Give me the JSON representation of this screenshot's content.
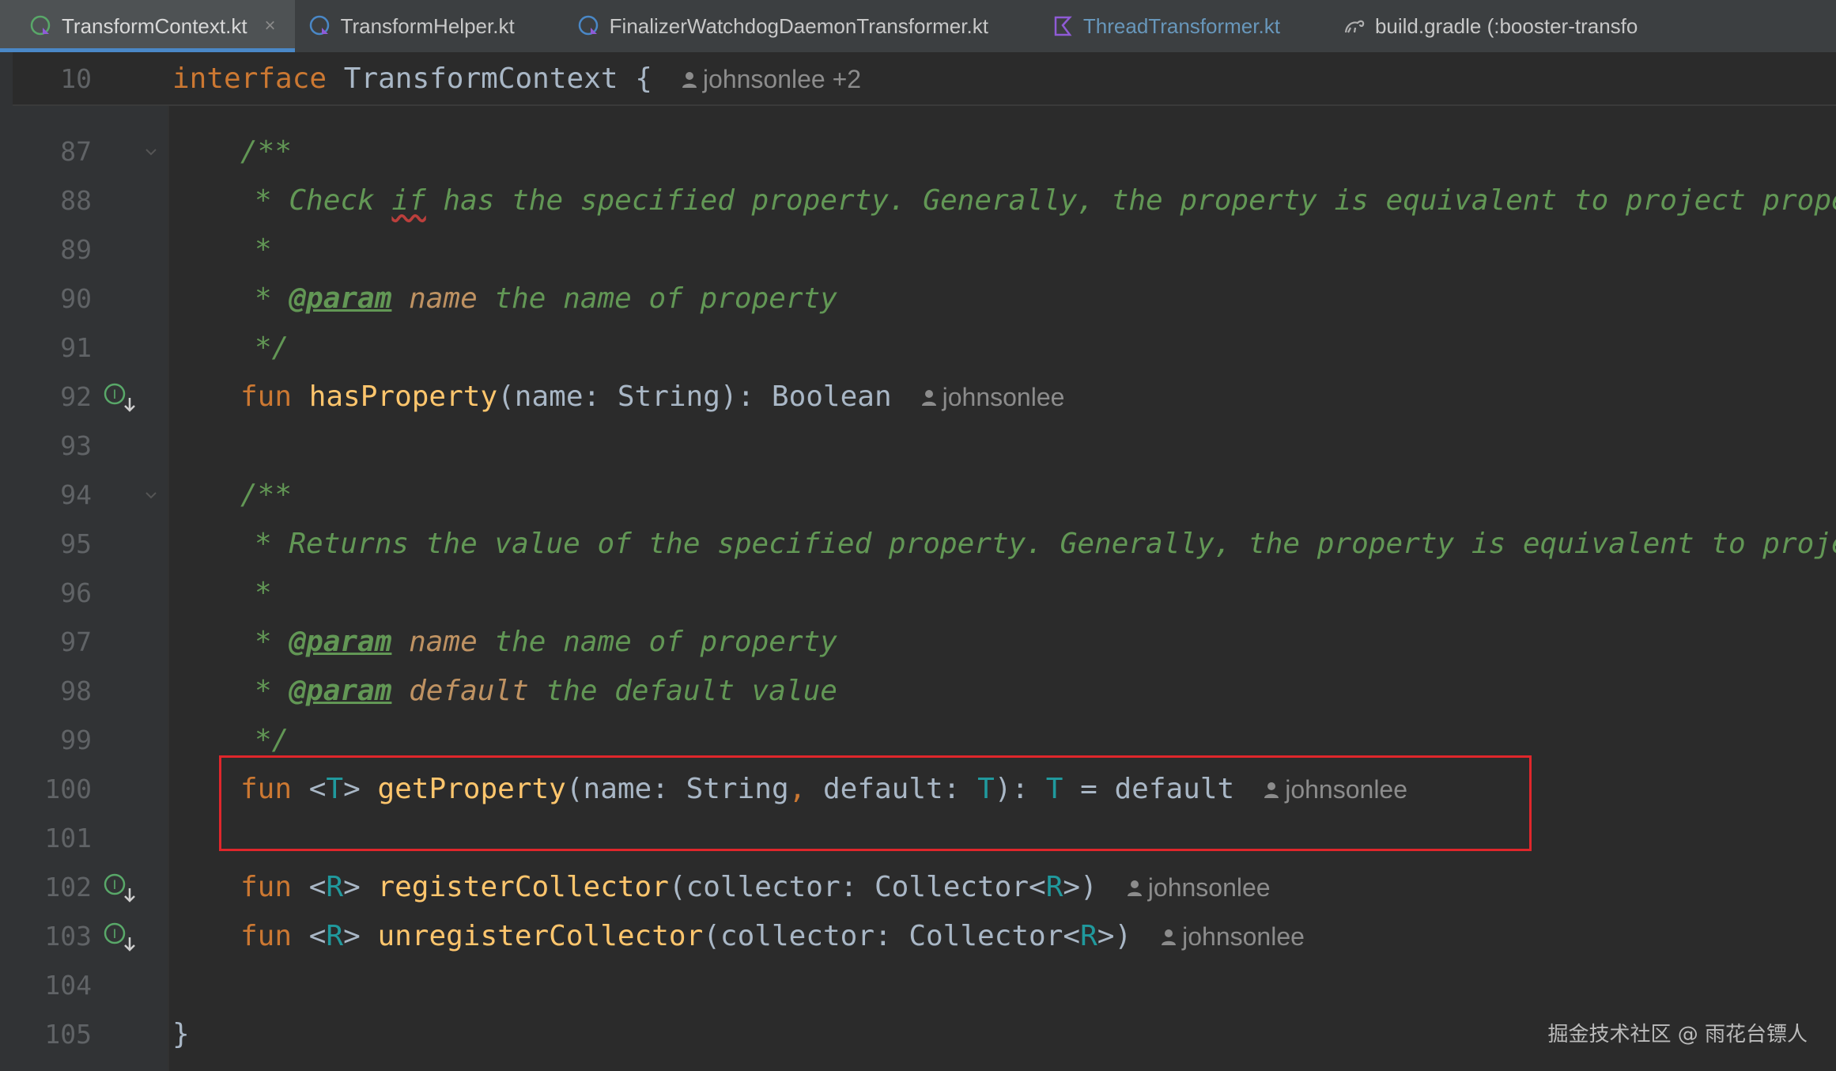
{
  "tabs": [
    {
      "label": "TransformContext.kt",
      "active": true,
      "close": "×"
    },
    {
      "label": "TransformHelper.kt"
    },
    {
      "label": "FinalizerWatchdogDaemonTransformer.kt"
    },
    {
      "label": "ThreadTransformer.kt"
    },
    {
      "label": "build.gradle (:booster-transfo"
    }
  ],
  "sticky": {
    "line": "10",
    "keyword": "interface",
    "name": "TransformContext",
    "brace": "{",
    "author": "johnsonlee +2"
  },
  "lines": {
    "l87": {
      "n": "87",
      "t": "/**"
    },
    "l88": {
      "n": "88",
      "a": "* Check ",
      "b": "if",
      "c": " has the specified property. Generally, the property is equivalent to project prope"
    },
    "l89": {
      "n": "89",
      "t": "*"
    },
    "l90": {
      "n": "90",
      "star": "* ",
      "tag": "@param",
      "pname": " name",
      "rest": " the name of property"
    },
    "l91": {
      "n": "91",
      "t": "*/"
    },
    "l92": {
      "n": "92",
      "kw": "fun ",
      "fn": "hasProperty",
      "rest": "(name: String): Boolean",
      "author": "johnsonlee"
    },
    "l93": {
      "n": "93"
    },
    "l94": {
      "n": "94",
      "t": "/**"
    },
    "l95": {
      "n": "95",
      "t": "* Returns the value of the specified property. Generally, the property is equivalent to proje"
    },
    "l96": {
      "n": "96",
      "t": "*"
    },
    "l97": {
      "n": "97",
      "star": "* ",
      "tag": "@param",
      "pname": " name",
      "rest": " the name of property"
    },
    "l98": {
      "n": "98",
      "star": "* ",
      "tag": "@param",
      "pname": " default",
      "rest": " the default value"
    },
    "l99": {
      "n": "99",
      "t": "*/"
    },
    "l100": {
      "n": "100",
      "kw": "fun ",
      "lt": "<",
      "tp": "T",
      "gt": "> ",
      "fn": "getProperty",
      "p1": "(name: String",
      "comma": ",",
      "p2": " default: ",
      "tp2": "T",
      "p3": "): ",
      "tp3": "T",
      "p4": " = default",
      "author": "johnsonlee"
    },
    "l101": {
      "n": "101"
    },
    "l102": {
      "n": "102",
      "kw": "fun ",
      "lt": "<",
      "tp": "R",
      "gt": "> ",
      "fn": "registerCollector",
      "p1": "(collector: Collector<",
      "tp2": "R",
      "p2": ">)",
      "author": "johnsonlee"
    },
    "l103": {
      "n": "103",
      "kw": "fun ",
      "lt": "<",
      "tp": "R",
      "gt": "> ",
      "fn": "unregisterCollector",
      "p1": "(collector: Collector<",
      "tp2": "R",
      "p2": ">)",
      "author": "johnsonlee"
    },
    "l104": {
      "n": "104"
    },
    "l105": {
      "n": "105",
      "t": "}"
    }
  },
  "watermark": "掘金技术社区 @ 雨花台镖人",
  "colors": {
    "background": "#2b2b2b",
    "gutter": "#313335",
    "keyword": "#cc7832",
    "function": "#ffc66d",
    "type_param": "#20999d",
    "comment": "#629755",
    "highlight_box": "#e0262b",
    "active_tab_underline": "#4a88c7"
  }
}
